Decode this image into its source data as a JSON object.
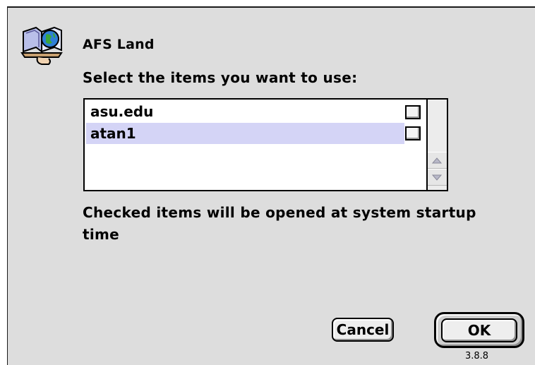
{
  "dialog": {
    "title": "AFS Land",
    "prompt": "Select the items you want to use:",
    "note": "Checked items will be opened at system startup time",
    "version": "3.8.8"
  },
  "list": {
    "items": [
      {
        "label": "asu.edu",
        "checked": false,
        "selected": false
      },
      {
        "label": "atan1",
        "checked": false,
        "selected": true
      }
    ]
  },
  "buttons": {
    "cancel_label": "Cancel",
    "ok_label": "OK"
  },
  "icons": {
    "app": "afs-land-icon",
    "scroll_up": "scroll-up-arrow-icon",
    "scroll_down": "scroll-down-arrow-icon"
  },
  "colors": {
    "dialog_background": "#dddddd",
    "selection_highlight": "#d4d4f6"
  }
}
